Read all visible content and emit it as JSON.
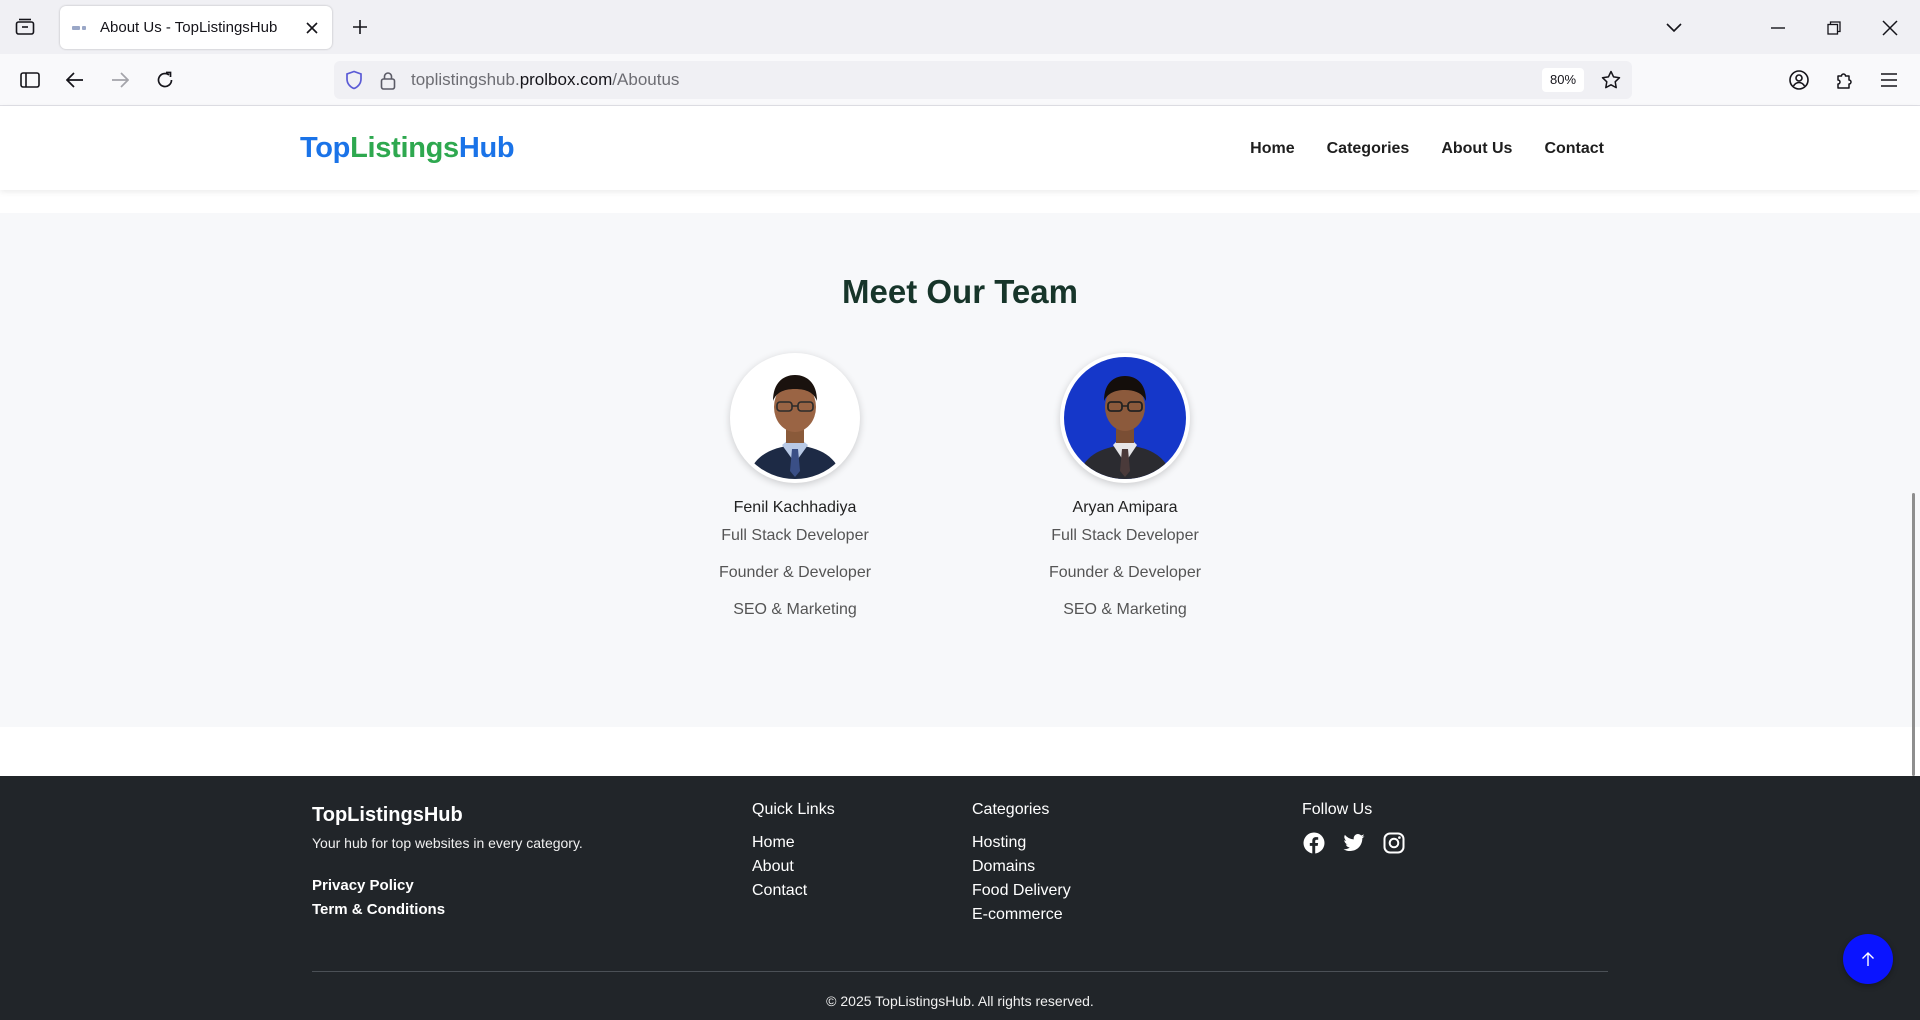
{
  "browser": {
    "tab_title": "About Us - TopListingsHub",
    "url_prefix": "toplistingshub.",
    "url_domain": "prolbox.com",
    "url_path": "/Aboutus",
    "zoom": "80%"
  },
  "site": {
    "logo_part1": "Top",
    "logo_part2": "Listings",
    "logo_part3": "Hub",
    "nav": [
      "Home",
      "Categories",
      "About Us",
      "Contact"
    ]
  },
  "team": {
    "heading": "Meet Our Team",
    "members": [
      {
        "name": "Fenil Kachhadiya",
        "roles": [
          "Full Stack Developer",
          "Founder & Developer",
          "SEO & Marketing"
        ],
        "photo_bg": "#ffffff"
      },
      {
        "name": "Aryan Amipara",
        "roles": [
          "Full Stack Developer",
          "Founder & Developer",
          "SEO & Marketing"
        ],
        "photo_bg": "#1537c9"
      }
    ]
  },
  "footer": {
    "brand": "TopListingsHub",
    "tagline": "Your hub for top websites in every category.",
    "legal": [
      "Privacy Policy",
      "Term & Conditions"
    ],
    "quick_links_title": "Quick Links",
    "quick_links": [
      "Home",
      "About",
      "Contact"
    ],
    "categories_title": "Categories",
    "categories": [
      "Hosting",
      "Domains",
      "Food Delivery",
      "E-commerce"
    ],
    "follow_title": "Follow Us",
    "social_icons": [
      "facebook-icon",
      "twitter-icon",
      "instagram-icon"
    ],
    "copyright": "© 2025 TopListingsHub. All rights reserved."
  },
  "colors": {
    "brand_blue": "#1a73e8",
    "brand_green": "#2ea84f",
    "footer_bg": "#212529",
    "to_top_button": "#0a14ff"
  }
}
